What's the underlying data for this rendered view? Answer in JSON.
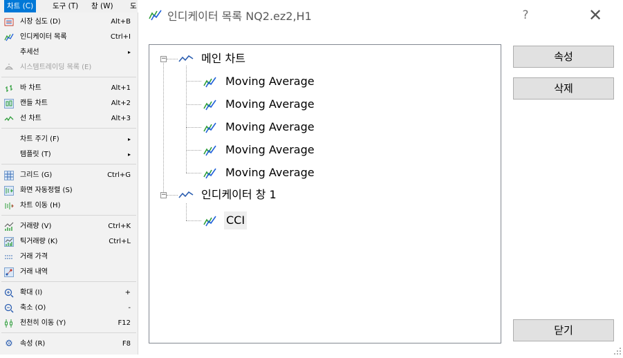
{
  "menubar": {
    "items": [
      "차트 (C)",
      "도구 (T)",
      "창 (W)",
      "도"
    ]
  },
  "menu": {
    "items": [
      {
        "icon": "market-depth-icon",
        "label": "시장 심도 (D)",
        "shortcut": "Alt+B"
      },
      {
        "icon": "indicator-icon",
        "label": "인디케이터 목록",
        "shortcut": "Ctrl+I"
      },
      {
        "icon": "",
        "label": "추세선",
        "submenu": "▸"
      },
      {
        "icon": "robot-icon",
        "label": "시스템트레이딩 목록 (E)",
        "disabled": true
      },
      {
        "icon": "bar-chart-icon",
        "label": "바 차트",
        "shortcut": "Alt+1"
      },
      {
        "icon": "candle-chart-icon",
        "label": "캔들 차트",
        "shortcut": "Alt+2"
      },
      {
        "icon": "line-chart-icon",
        "label": "선 차트",
        "shortcut": "Alt+3"
      },
      {
        "icon": "",
        "label": "차트 주기 (F)",
        "submenu": "▸"
      },
      {
        "icon": "",
        "label": "템플릿 (T)",
        "submenu": "▸"
      },
      {
        "icon": "grid-icon",
        "label": "그리드 (G)",
        "shortcut": "Ctrl+G"
      },
      {
        "icon": "auto-scroll-icon",
        "label": "화면 자동정렬 (S)"
      },
      {
        "icon": "chart-shift-icon",
        "label": "차트 이동 (H)"
      },
      {
        "icon": "volume-icon",
        "label": "거래량 (V)",
        "shortcut": "Ctrl+K"
      },
      {
        "icon": "tick-volume-icon",
        "label": "틱거래량 (K)",
        "shortcut": "Ctrl+L"
      },
      {
        "icon": "trade-price-icon",
        "label": "거래 가격"
      },
      {
        "icon": "trade-history-icon",
        "label": "거래 내역"
      },
      {
        "icon": "zoom-in-icon",
        "label": "확대 (I)",
        "shortcut": "+"
      },
      {
        "icon": "zoom-out-icon",
        "label": "축소 (O)",
        "shortcut": "-"
      },
      {
        "icon": "step-icon",
        "label": "천천히 이동 (Y)",
        "shortcut": "F12"
      },
      {
        "icon": "gear-icon",
        "label": "속성 (R)",
        "shortcut": "F8"
      }
    ]
  },
  "dialog": {
    "title": "인디케이터 목록 NQ2.ez2,H1",
    "help": "?",
    "close": "✕",
    "tree": {
      "main": {
        "label": "메인 차트",
        "children": [
          "Moving Average",
          "Moving Average",
          "Moving Average",
          "Moving Average",
          "Moving Average"
        ]
      },
      "window1": {
        "label": "인디케이터 창 1",
        "children": [
          "CCI"
        ]
      }
    },
    "buttons": {
      "properties": "속성",
      "delete": "삭제",
      "close": "닫기"
    }
  },
  "colors": {
    "accent": "#0078d7",
    "indicator_green": "#2e9e3a",
    "indicator_blue": "#1e5fd8"
  }
}
